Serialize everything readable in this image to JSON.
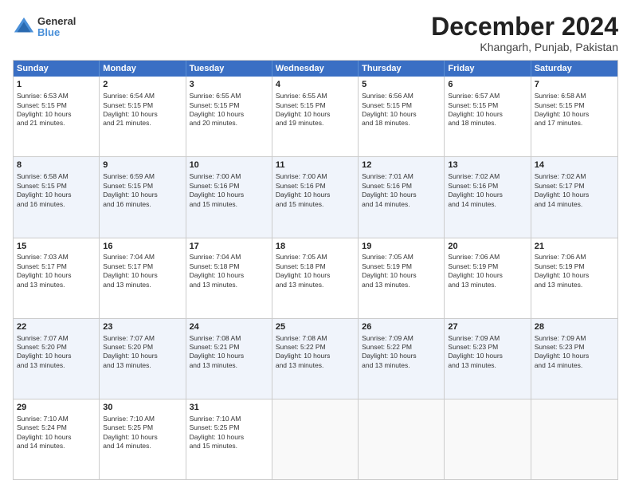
{
  "logo": {
    "general": "General",
    "blue": "Blue"
  },
  "title": "December 2024",
  "subtitle": "Khangarh, Punjab, Pakistan",
  "header_days": [
    "Sunday",
    "Monday",
    "Tuesday",
    "Wednesday",
    "Thursday",
    "Friday",
    "Saturday"
  ],
  "rows": [
    [
      {
        "day": "1",
        "lines": [
          "Sunrise: 6:53 AM",
          "Sunset: 5:15 PM",
          "Daylight: 10 hours",
          "and 21 minutes."
        ]
      },
      {
        "day": "2",
        "lines": [
          "Sunrise: 6:54 AM",
          "Sunset: 5:15 PM",
          "Daylight: 10 hours",
          "and 21 minutes."
        ]
      },
      {
        "day": "3",
        "lines": [
          "Sunrise: 6:55 AM",
          "Sunset: 5:15 PM",
          "Daylight: 10 hours",
          "and 20 minutes."
        ]
      },
      {
        "day": "4",
        "lines": [
          "Sunrise: 6:55 AM",
          "Sunset: 5:15 PM",
          "Daylight: 10 hours",
          "and 19 minutes."
        ]
      },
      {
        "day": "5",
        "lines": [
          "Sunrise: 6:56 AM",
          "Sunset: 5:15 PM",
          "Daylight: 10 hours",
          "and 18 minutes."
        ]
      },
      {
        "day": "6",
        "lines": [
          "Sunrise: 6:57 AM",
          "Sunset: 5:15 PM",
          "Daylight: 10 hours",
          "and 18 minutes."
        ]
      },
      {
        "day": "7",
        "lines": [
          "Sunrise: 6:58 AM",
          "Sunset: 5:15 PM",
          "Daylight: 10 hours",
          "and 17 minutes."
        ]
      }
    ],
    [
      {
        "day": "8",
        "lines": [
          "Sunrise: 6:58 AM",
          "Sunset: 5:15 PM",
          "Daylight: 10 hours",
          "and 16 minutes."
        ]
      },
      {
        "day": "9",
        "lines": [
          "Sunrise: 6:59 AM",
          "Sunset: 5:15 PM",
          "Daylight: 10 hours",
          "and 16 minutes."
        ]
      },
      {
        "day": "10",
        "lines": [
          "Sunrise: 7:00 AM",
          "Sunset: 5:16 PM",
          "Daylight: 10 hours",
          "and 15 minutes."
        ]
      },
      {
        "day": "11",
        "lines": [
          "Sunrise: 7:00 AM",
          "Sunset: 5:16 PM",
          "Daylight: 10 hours",
          "and 15 minutes."
        ]
      },
      {
        "day": "12",
        "lines": [
          "Sunrise: 7:01 AM",
          "Sunset: 5:16 PM",
          "Daylight: 10 hours",
          "and 14 minutes."
        ]
      },
      {
        "day": "13",
        "lines": [
          "Sunrise: 7:02 AM",
          "Sunset: 5:16 PM",
          "Daylight: 10 hours",
          "and 14 minutes."
        ]
      },
      {
        "day": "14",
        "lines": [
          "Sunrise: 7:02 AM",
          "Sunset: 5:17 PM",
          "Daylight: 10 hours",
          "and 14 minutes."
        ]
      }
    ],
    [
      {
        "day": "15",
        "lines": [
          "Sunrise: 7:03 AM",
          "Sunset: 5:17 PM",
          "Daylight: 10 hours",
          "and 13 minutes."
        ]
      },
      {
        "day": "16",
        "lines": [
          "Sunrise: 7:04 AM",
          "Sunset: 5:17 PM",
          "Daylight: 10 hours",
          "and 13 minutes."
        ]
      },
      {
        "day": "17",
        "lines": [
          "Sunrise: 7:04 AM",
          "Sunset: 5:18 PM",
          "Daylight: 10 hours",
          "and 13 minutes."
        ]
      },
      {
        "day": "18",
        "lines": [
          "Sunrise: 7:05 AM",
          "Sunset: 5:18 PM",
          "Daylight: 10 hours",
          "and 13 minutes."
        ]
      },
      {
        "day": "19",
        "lines": [
          "Sunrise: 7:05 AM",
          "Sunset: 5:19 PM",
          "Daylight: 10 hours",
          "and 13 minutes."
        ]
      },
      {
        "day": "20",
        "lines": [
          "Sunrise: 7:06 AM",
          "Sunset: 5:19 PM",
          "Daylight: 10 hours",
          "and 13 minutes."
        ]
      },
      {
        "day": "21",
        "lines": [
          "Sunrise: 7:06 AM",
          "Sunset: 5:19 PM",
          "Daylight: 10 hours",
          "and 13 minutes."
        ]
      }
    ],
    [
      {
        "day": "22",
        "lines": [
          "Sunrise: 7:07 AM",
          "Sunset: 5:20 PM",
          "Daylight: 10 hours",
          "and 13 minutes."
        ]
      },
      {
        "day": "23",
        "lines": [
          "Sunrise: 7:07 AM",
          "Sunset: 5:20 PM",
          "Daylight: 10 hours",
          "and 13 minutes."
        ]
      },
      {
        "day": "24",
        "lines": [
          "Sunrise: 7:08 AM",
          "Sunset: 5:21 PM",
          "Daylight: 10 hours",
          "and 13 minutes."
        ]
      },
      {
        "day": "25",
        "lines": [
          "Sunrise: 7:08 AM",
          "Sunset: 5:22 PM",
          "Daylight: 10 hours",
          "and 13 minutes."
        ]
      },
      {
        "day": "26",
        "lines": [
          "Sunrise: 7:09 AM",
          "Sunset: 5:22 PM",
          "Daylight: 10 hours",
          "and 13 minutes."
        ]
      },
      {
        "day": "27",
        "lines": [
          "Sunrise: 7:09 AM",
          "Sunset: 5:23 PM",
          "Daylight: 10 hours",
          "and 13 minutes."
        ]
      },
      {
        "day": "28",
        "lines": [
          "Sunrise: 7:09 AM",
          "Sunset: 5:23 PM",
          "Daylight: 10 hours",
          "and 14 minutes."
        ]
      }
    ],
    [
      {
        "day": "29",
        "lines": [
          "Sunrise: 7:10 AM",
          "Sunset: 5:24 PM",
          "Daylight: 10 hours",
          "and 14 minutes."
        ]
      },
      {
        "day": "30",
        "lines": [
          "Sunrise: 7:10 AM",
          "Sunset: 5:25 PM",
          "Daylight: 10 hours",
          "and 14 minutes."
        ]
      },
      {
        "day": "31",
        "lines": [
          "Sunrise: 7:10 AM",
          "Sunset: 5:25 PM",
          "Daylight: 10 hours",
          "and 15 minutes."
        ]
      },
      {
        "day": "",
        "lines": []
      },
      {
        "day": "",
        "lines": []
      },
      {
        "day": "",
        "lines": []
      },
      {
        "day": "",
        "lines": []
      }
    ]
  ]
}
